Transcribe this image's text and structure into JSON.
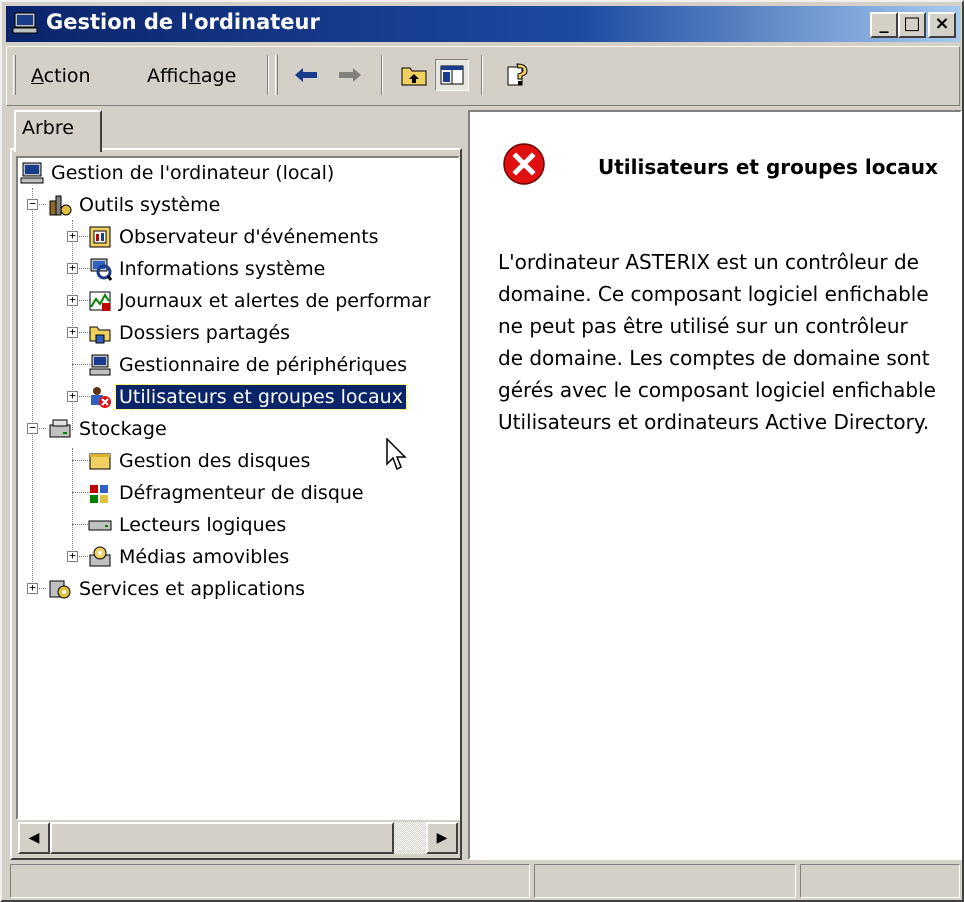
{
  "window": {
    "title": "Gestion de l'ordinateur"
  },
  "titlebar_buttons": {
    "minimize": "_",
    "maximize": "□",
    "close": "×"
  },
  "menu": {
    "action": {
      "before": "",
      "key": "A",
      "after": "ction"
    },
    "affichage": {
      "before": "Affic",
      "key": "h",
      "after": "age"
    }
  },
  "tab": {
    "label": "Arbre"
  },
  "tree": [
    {
      "id": "root",
      "label": "Gestion de l'ordinateur (local)",
      "icon": "computer-icon"
    },
    {
      "id": "outils",
      "label": "Outils système",
      "icon": "tools-icon"
    },
    {
      "id": "observateur",
      "label": "Observateur d'événements",
      "icon": "event-viewer-icon"
    },
    {
      "id": "informations",
      "label": "Informations système",
      "icon": "system-info-icon"
    },
    {
      "id": "journaux",
      "label": "Journaux et alertes de performar",
      "icon": "performance-icon"
    },
    {
      "id": "dossiers",
      "label": "Dossiers partagés",
      "icon": "shared-folder-icon"
    },
    {
      "id": "gestionnaire",
      "label": "Gestionnaire de périphériques",
      "icon": "device-manager-icon"
    },
    {
      "id": "utilisateurs",
      "label": "Utilisateurs et groupes locaux",
      "icon": "users-error-icon"
    },
    {
      "id": "stockage",
      "label": "Stockage",
      "icon": "storage-icon"
    },
    {
      "id": "disques",
      "label": "Gestion des disques",
      "icon": "disk-management-icon"
    },
    {
      "id": "defrag",
      "label": "Défragmenteur de disque",
      "icon": "defrag-icon"
    },
    {
      "id": "lecteurs",
      "label": "Lecteurs logiques",
      "icon": "logical-drive-icon"
    },
    {
      "id": "medias",
      "label": "Médias amovibles",
      "icon": "removable-media-icon"
    },
    {
      "id": "services",
      "label": "Services et applications",
      "icon": "services-icon"
    }
  ],
  "detail": {
    "title": "Utilisateurs et groupes locaux",
    "message": "L'ordinateur ASTERIX est un contrôleur de domaine. Ce composant logiciel enfichable ne peut pas être utilisé sur un contrôleur de domaine. Les comptes de domaine sont gérés avec le composant logiciel enfichable Utilisateurs et ordinateurs Active Directory.",
    "icon": "error-icon"
  },
  "colors": {
    "title_active": "#0a246a",
    "selection": "#0a246a",
    "face": "#d4d0c8",
    "error_red": "#e01010"
  }
}
